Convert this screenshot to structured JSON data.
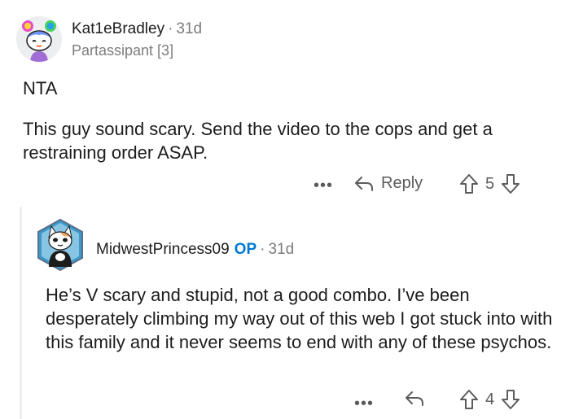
{
  "comment": {
    "author": "Kat1eBradley",
    "time": "31d",
    "flair": "Partassipant [3]",
    "lines": [
      "NTA"
    ],
    "body": "This guy sound scary. Send the video to the cops and get a restraining order ASAP.",
    "actions": {
      "more": "•••",
      "reply_label": "Reply",
      "score": "5"
    }
  },
  "reply": {
    "author": "MidwestPrincess09",
    "op_badge": "OP",
    "time": "31d",
    "body": "He’s V scary and stupid, not a good combo. I’ve been desperately climbing my way out of this web I got stuck into with this family and it never seems to end with any of these psychos.",
    "actions": {
      "more": "•••",
      "score": "4"
    }
  },
  "separator": "·",
  "icons": {
    "reply": "reply-arrow-icon",
    "upvote": "upvote-arrow-icon",
    "downvote": "downvote-arrow-icon",
    "more": "more-dots-icon"
  },
  "colors": {
    "meta": "#7c7c7c",
    "op": "#0079d3",
    "text": "#1c1c1c",
    "action": "#5c5c5c"
  }
}
